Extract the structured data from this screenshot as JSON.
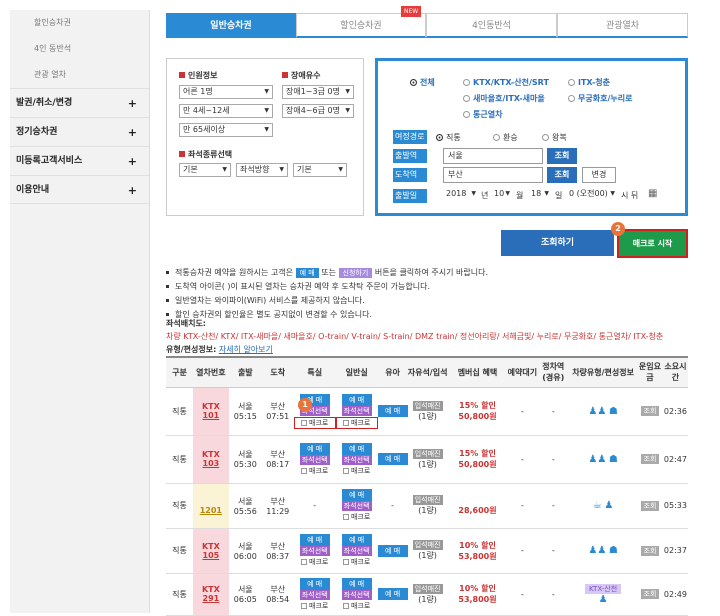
{
  "sidebar": {
    "subitems": [
      "할인승차권",
      "4인 동반석",
      "관광 열차"
    ],
    "menus": [
      "발권/취소/변경",
      "정기승차권",
      "미등록고객서비스",
      "이용안내"
    ],
    "plus": "+"
  },
  "tabs": [
    "일반승차권",
    "할인승차권",
    "4인동반석",
    "관광열차"
  ],
  "new_badge": "NEW",
  "passenger": {
    "title": "인원정보",
    "adult": "어른 1명",
    "child": "만 4세~12세",
    "senior": "만 65세이상",
    "disabled_title": "장애유수",
    "dis13": "장애1~3급 0명",
    "dis46": "장애4~6급 0명",
    "seat_title": "좌석종류선택",
    "seat1": "기본",
    "seat2": "좌석방향",
    "seat3": "기본"
  },
  "search": {
    "trains": [
      "전체",
      "KTX/KTX-산천/SRT",
      "ITX-청춘",
      "새마을호/ITX-새마을",
      "무궁화호/누리로",
      "통근열차"
    ],
    "route_label": "여정경로",
    "route_opts": [
      "직통",
      "환승",
      "왕복"
    ],
    "dep_label": "출발역",
    "dep_value": "서울",
    "arr_label": "도착역",
    "arr_value": "부산",
    "lookup": "조회",
    "change": "변경",
    "date_label": "출발일",
    "year": "2018",
    "year_unit": "년",
    "month": "10",
    "month_unit": "월",
    "day": "18",
    "day_unit": "일",
    "hour": "0 (오전00)",
    "hour_unit": "시 뒤"
  },
  "buttons": {
    "search": "조회하기",
    "macro": "매크로 시작",
    "step1": "1",
    "step2": "2"
  },
  "notes": {
    "n1a": "적통승차권 예약을 원하시는 고객은",
    "n1k1": "예 매",
    "n1b": "또는",
    "n1k2": "신청하기",
    "n1c": "버튼을 클릭하여 주시기 바랍니다.",
    "n2": "도착역 아이콘(   )이 표시된 열차는 승차권 예약 후 도착탁 주문이 가능합니다.",
    "n3": "일반열차는 와이파이(WiFi) 서비스를 제공하지 않습니다.",
    "n4": "할인 승차권의 할인율은 별도 공지없이 변경할 수 있습니다."
  },
  "legend": {
    "title": "좌석배치도:",
    "line": "차량  KTX-산천/ KTX/ ITX-새마을/ 새마을호/ O-train/ V-train/ S-train/ DMZ train/ 정선아리랑/ 서해금빛/ 누리로/ 무궁화호/ 통근열차/ ITX-청춘",
    "info_label": "유형/편성정보:",
    "info_link": "자세히 알아보기"
  },
  "table": {
    "headers": [
      "구분",
      "열차번호",
      "출발",
      "도착",
      "특실",
      "일반실",
      "유아",
      "자유석/입석",
      "멤버십 혜택",
      "예약대기",
      "정차역(경유)",
      "차량유형/편성정보",
      "운임요금",
      "소요시간"
    ],
    "reserve": "예 매",
    "choice": "좌석선택",
    "macro": "매크로",
    "standing": "입석매진",
    "standing_sub": "(1량)",
    "dash": "-",
    "fare_btn": "조회",
    "rows": [
      {
        "type": "직통",
        "line": "KTX",
        "no": "101",
        "dep": "서울",
        "dt": "05:15",
        "arr": "부산",
        "at": "07:51",
        "disc": "15% 할인",
        "price": "50,800원",
        "dur": "02:36",
        "yellow": false,
        "special": true,
        "infant": true,
        "car": "seat"
      },
      {
        "type": "직통",
        "line": "KTX",
        "no": "103",
        "dep": "서울",
        "dt": "05:30",
        "arr": "부산",
        "at": "08:17",
        "disc": "15% 할인",
        "price": "50,800원",
        "dur": "02:47",
        "yellow": false,
        "special": true,
        "infant": true,
        "car": "seat"
      },
      {
        "type": "직통",
        "line": "",
        "no": "1201",
        "dep": "서울",
        "dt": "05:56",
        "arr": "부산",
        "at": "11:29",
        "disc": "",
        "price": "28,600원",
        "dur": "05:33",
        "yellow": true,
        "special": false,
        "infant": false,
        "car": "bed"
      },
      {
        "type": "직통",
        "line": "KTX",
        "no": "105",
        "dep": "서울",
        "dt": "06:00",
        "arr": "부산",
        "at": "08:37",
        "disc": "10% 할인",
        "price": "53,800원",
        "dur": "02:37",
        "yellow": false,
        "special": true,
        "infant": true,
        "car": "seat"
      },
      {
        "type": "직통",
        "line": "KTX",
        "no": "291",
        "dep": "서울",
        "dt": "06:05",
        "arr": "부산",
        "at": "08:54",
        "disc": "10% 할인",
        "price": "53,800원",
        "dur": "02:49",
        "yellow": false,
        "special": true,
        "infant": true,
        "car": "KTX-산천"
      }
    ]
  }
}
